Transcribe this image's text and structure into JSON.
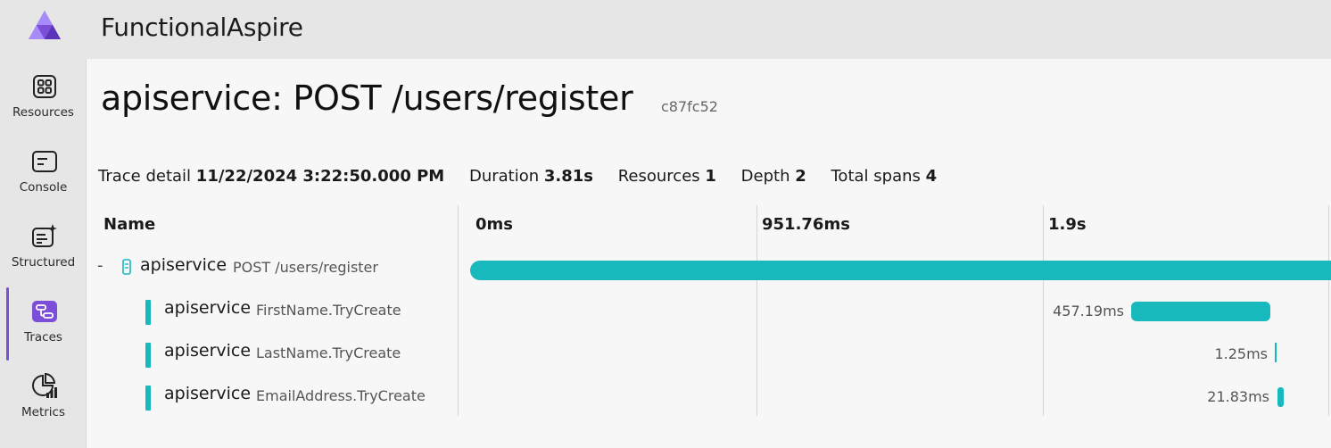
{
  "app": {
    "title": "FunctionalAspire",
    "accent": "#7b4fd8",
    "span_color": "#17b9bd"
  },
  "sidebar": {
    "items": [
      {
        "label": "Resources",
        "icon": "resources-grid-icon"
      },
      {
        "label": "Console",
        "icon": "console-icon"
      },
      {
        "label": "Structured",
        "icon": "structured-logs-icon"
      },
      {
        "label": "Traces",
        "icon": "traces-icon",
        "active": true
      },
      {
        "label": "Metrics",
        "icon": "metrics-icon"
      }
    ]
  },
  "page": {
    "title": "apiservice: POST /users/register",
    "trace_id": "c87fc52"
  },
  "summary": {
    "trace_detail_label": "Trace detail",
    "trace_detail_value": "11/22/2024 3:22:50.000 PM",
    "duration_label": "Duration",
    "duration_value": "3.81s",
    "resources_label": "Resources",
    "resources_value": "1",
    "depth_label": "Depth",
    "depth_value": "2",
    "total_spans_label": "Total spans",
    "total_spans_value": "4"
  },
  "grid": {
    "name_header": "Name",
    "ticks": [
      "0ms",
      "951.76ms",
      "1.9s"
    ],
    "spans": [
      {
        "toggle": "-",
        "service": "apiservice",
        "operation": "POST /users/register",
        "duration": ""
      },
      {
        "service": "apiservice",
        "operation": "FirstName.TryCreate",
        "duration": "457.19ms"
      },
      {
        "service": "apiservice",
        "operation": "LastName.TryCreate",
        "duration": "1.25ms"
      },
      {
        "service": "apiservice",
        "operation": "EmailAddress.TryCreate",
        "duration": "21.83ms"
      }
    ]
  }
}
